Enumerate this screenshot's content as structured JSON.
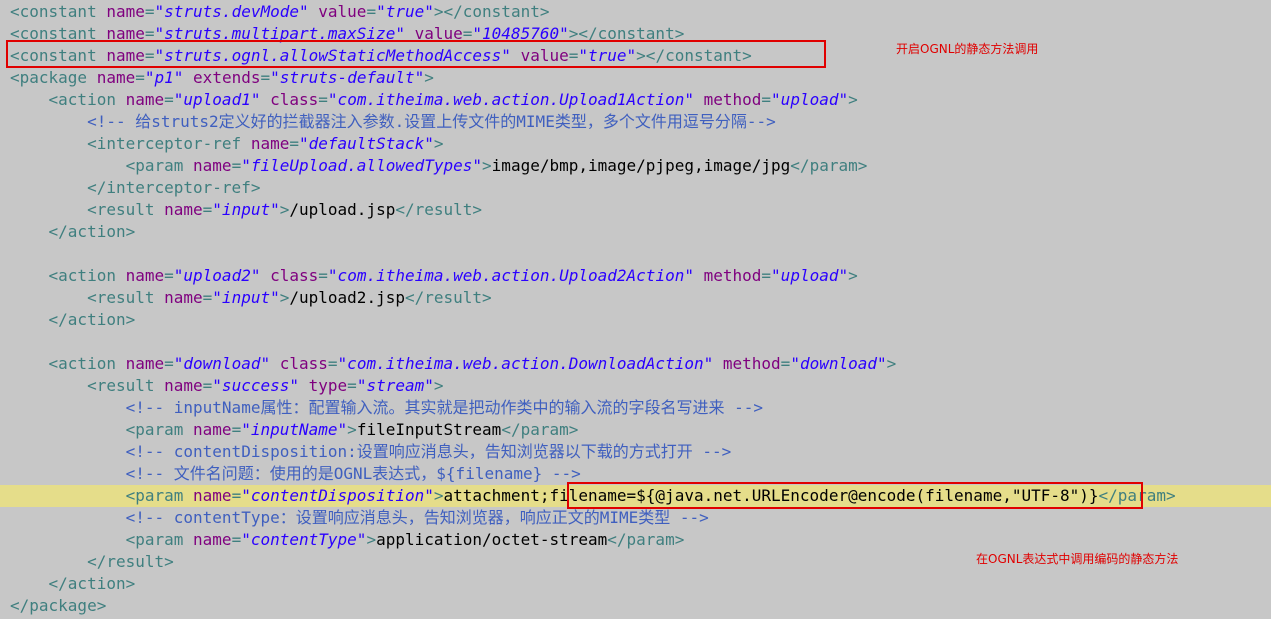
{
  "colors": {
    "background": "#c7c7c7",
    "highlight_line": "#e5dd8a",
    "tag": "#3f7f7f",
    "attribute": "#7f007f",
    "value": "#2a00ff",
    "comment": "#3f5fbf",
    "annotation": "#e00000"
  },
  "annotations": {
    "static_access_note": "开启OGNL的静态方法调用",
    "encode_note": "在OGNL表达式中调用编码的静态方法"
  },
  "code": {
    "lines": [
      [
        [
          "tag",
          "<constant "
        ],
        [
          "attr",
          "name"
        ],
        [
          "tag",
          "="
        ],
        [
          "val",
          "\"struts.devMode\""
        ],
        [
          "tag",
          " "
        ],
        [
          "attr",
          "value"
        ],
        [
          "tag",
          "="
        ],
        [
          "val",
          "\"true\""
        ],
        [
          "tag",
          "></constant>"
        ]
      ],
      [
        [
          "tag",
          "<constant "
        ],
        [
          "attr",
          "name"
        ],
        [
          "tag",
          "="
        ],
        [
          "val",
          "\"struts.multipart.maxSize\""
        ],
        [
          "tag",
          " "
        ],
        [
          "attr",
          "value"
        ],
        [
          "tag",
          "="
        ],
        [
          "val",
          "\"10485760\""
        ],
        [
          "tag",
          "></constant>"
        ]
      ],
      [
        [
          "tag",
          "<constant "
        ],
        [
          "attr",
          "name"
        ],
        [
          "tag",
          "="
        ],
        [
          "val",
          "\"struts.ognl.allowStaticMethodAccess\""
        ],
        [
          "tag",
          " "
        ],
        [
          "attr",
          "value"
        ],
        [
          "tag",
          "="
        ],
        [
          "val",
          "\"true\""
        ],
        [
          "tag",
          "></constant>"
        ]
      ],
      [
        [
          "tag",
          "<package "
        ],
        [
          "attr",
          "name"
        ],
        [
          "tag",
          "="
        ],
        [
          "val",
          "\"p1\""
        ],
        [
          "tag",
          " "
        ],
        [
          "attr",
          "extends"
        ],
        [
          "tag",
          "="
        ],
        [
          "val",
          "\"struts-default\""
        ],
        [
          "tag",
          ">"
        ]
      ],
      [
        [
          "txt",
          "    "
        ],
        [
          "tag",
          "<action "
        ],
        [
          "attr",
          "name"
        ],
        [
          "tag",
          "="
        ],
        [
          "val",
          "\"upload1\""
        ],
        [
          "tag",
          " "
        ],
        [
          "attr",
          "class"
        ],
        [
          "tag",
          "="
        ],
        [
          "val",
          "\"com.itheima.web.action.Upload1Action\""
        ],
        [
          "tag",
          " "
        ],
        [
          "attr",
          "method"
        ],
        [
          "tag",
          "="
        ],
        [
          "val",
          "\"upload\""
        ],
        [
          "tag",
          ">"
        ]
      ],
      [
        [
          "txt",
          "        "
        ],
        [
          "cmt",
          "<!-- 给struts2定义好的拦截器注入参数.设置上传文件的MIME类型，多个文件用逗号分隔-->"
        ]
      ],
      [
        [
          "txt",
          "        "
        ],
        [
          "tag",
          "<interceptor-ref "
        ],
        [
          "attr",
          "name"
        ],
        [
          "tag",
          "="
        ],
        [
          "val",
          "\"defaultStack\""
        ],
        [
          "tag",
          ">"
        ]
      ],
      [
        [
          "txt",
          "            "
        ],
        [
          "tag",
          "<param "
        ],
        [
          "attr",
          "name"
        ],
        [
          "tag",
          "="
        ],
        [
          "val",
          "\"fileUpload.allowedTypes\""
        ],
        [
          "tag",
          ">"
        ],
        [
          "txt",
          "image/bmp,image/pjpeg,image/jpg"
        ],
        [
          "tag",
          "</param>"
        ]
      ],
      [
        [
          "txt",
          "        "
        ],
        [
          "tag",
          "</interceptor-ref>"
        ]
      ],
      [
        [
          "txt",
          "        "
        ],
        [
          "tag",
          "<result "
        ],
        [
          "attr",
          "name"
        ],
        [
          "tag",
          "="
        ],
        [
          "val",
          "\"input\""
        ],
        [
          "tag",
          ">"
        ],
        [
          "txt",
          "/upload.jsp"
        ],
        [
          "tag",
          "</result>"
        ]
      ],
      [
        [
          "txt",
          "    "
        ],
        [
          "tag",
          "</action>"
        ]
      ],
      [],
      [
        [
          "txt",
          "    "
        ],
        [
          "tag",
          "<action "
        ],
        [
          "attr",
          "name"
        ],
        [
          "tag",
          "="
        ],
        [
          "val",
          "\"upload2\""
        ],
        [
          "tag",
          " "
        ],
        [
          "attr",
          "class"
        ],
        [
          "tag",
          "="
        ],
        [
          "val",
          "\"com.itheima.web.action.Upload2Action\""
        ],
        [
          "tag",
          " "
        ],
        [
          "attr",
          "method"
        ],
        [
          "tag",
          "="
        ],
        [
          "val",
          "\"upload\""
        ],
        [
          "tag",
          ">"
        ]
      ],
      [
        [
          "txt",
          "        "
        ],
        [
          "tag",
          "<result "
        ],
        [
          "attr",
          "name"
        ],
        [
          "tag",
          "="
        ],
        [
          "val",
          "\"input\""
        ],
        [
          "tag",
          ">"
        ],
        [
          "txt",
          "/upload2.jsp"
        ],
        [
          "tag",
          "</result>"
        ]
      ],
      [
        [
          "txt",
          "    "
        ],
        [
          "tag",
          "</action>"
        ]
      ],
      [],
      [
        [
          "txt",
          "    "
        ],
        [
          "tag",
          "<action "
        ],
        [
          "attr",
          "name"
        ],
        [
          "tag",
          "="
        ],
        [
          "val",
          "\"download\""
        ],
        [
          "tag",
          " "
        ],
        [
          "attr",
          "class"
        ],
        [
          "tag",
          "="
        ],
        [
          "val",
          "\"com.itheima.web.action.DownloadAction\""
        ],
        [
          "tag",
          " "
        ],
        [
          "attr",
          "method"
        ],
        [
          "tag",
          "="
        ],
        [
          "val",
          "\"download\""
        ],
        [
          "tag",
          ">"
        ]
      ],
      [
        [
          "txt",
          "        "
        ],
        [
          "tag",
          "<result "
        ],
        [
          "attr",
          "name"
        ],
        [
          "tag",
          "="
        ],
        [
          "val",
          "\"success\""
        ],
        [
          "tag",
          " "
        ],
        [
          "attr",
          "type"
        ],
        [
          "tag",
          "="
        ],
        [
          "val",
          "\"stream\""
        ],
        [
          "tag",
          ">"
        ]
      ],
      [
        [
          "txt",
          "            "
        ],
        [
          "cmt",
          "<!-- inputName属性：配置输入流。其实就是把动作类中的输入流的字段名写进来 -->"
        ]
      ],
      [
        [
          "txt",
          "            "
        ],
        [
          "tag",
          "<param "
        ],
        [
          "attr",
          "name"
        ],
        [
          "tag",
          "="
        ],
        [
          "val",
          "\"inputName\""
        ],
        [
          "tag",
          ">"
        ],
        [
          "txt",
          "fileInputStream"
        ],
        [
          "tag",
          "</param>"
        ]
      ],
      [
        [
          "txt",
          "            "
        ],
        [
          "cmt",
          "<!-- contentDisposition:设置响应消息头，告知浏览器以下载的方式打开 -->"
        ]
      ],
      [
        [
          "txt",
          "            "
        ],
        [
          "cmt",
          "<!-- 文件名问题：使用的是OGNL表达式，${filename} -->"
        ]
      ],
      [
        [
          "txt",
          "            "
        ],
        [
          "tag",
          "<param "
        ],
        [
          "attr",
          "name"
        ],
        [
          "tag",
          "="
        ],
        [
          "val",
          "\"contentDisposition\""
        ],
        [
          "tag",
          ">"
        ],
        [
          "txt",
          "attachment;filename=${@java.net.URLEncoder@encode(filename,\"UTF-8\")}"
        ],
        [
          "tag",
          "</param>"
        ]
      ],
      [
        [
          "txt",
          "            "
        ],
        [
          "cmt",
          "<!-- contentType：设置响应消息头，告知浏览器，响应正文的MIME类型 -->"
        ]
      ],
      [
        [
          "txt",
          "            "
        ],
        [
          "tag",
          "<param "
        ],
        [
          "attr",
          "name"
        ],
        [
          "tag",
          "="
        ],
        [
          "val",
          "\"contentType\""
        ],
        [
          "tag",
          ">"
        ],
        [
          "txt",
          "application/octet-stream"
        ],
        [
          "tag",
          "</param>"
        ]
      ],
      [
        [
          "txt",
          "        "
        ],
        [
          "tag",
          "</result>"
        ]
      ],
      [
        [
          "txt",
          "    "
        ],
        [
          "tag",
          "</action>"
        ]
      ],
      [
        [
          "tag",
          "</package>"
        ]
      ]
    ]
  }
}
